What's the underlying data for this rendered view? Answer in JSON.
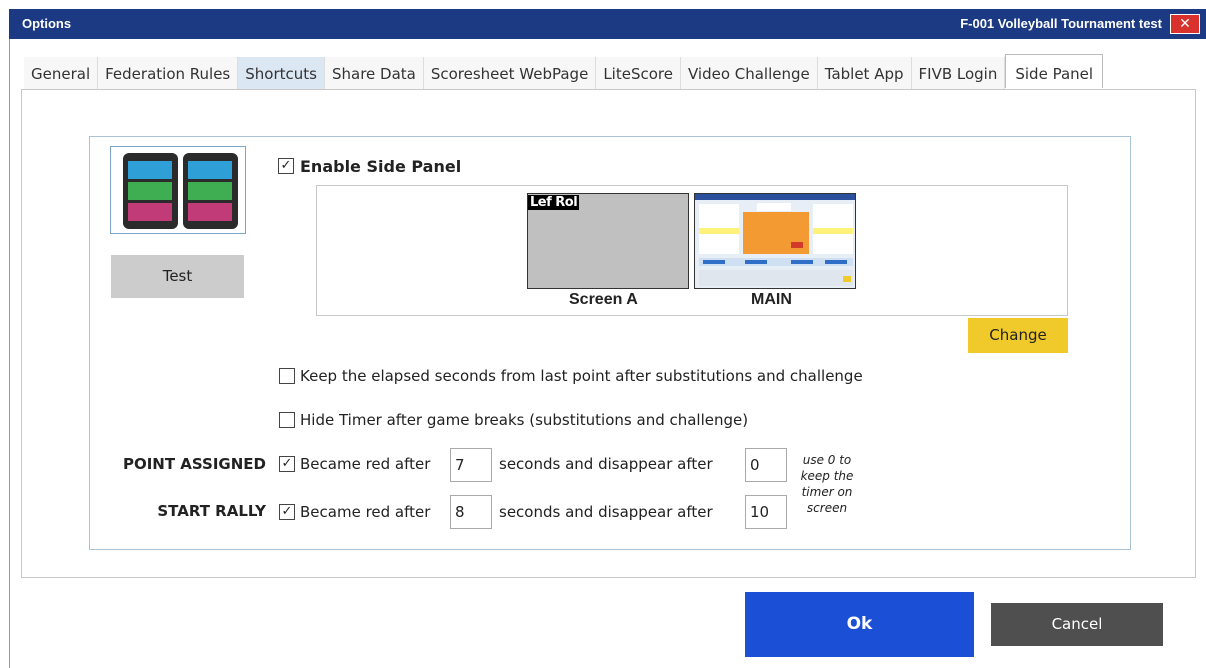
{
  "window": {
    "title": "Options",
    "event_title": "F-001  Volleyball Tournament test",
    "close_label": "✕"
  },
  "tabs": [
    {
      "label": "General"
    },
    {
      "label": "Federation Rules"
    },
    {
      "label": "Shortcuts"
    },
    {
      "label": "Share Data"
    },
    {
      "label": "Scoresheet WebPage"
    },
    {
      "label": "LiteScore"
    },
    {
      "label": "Video Challenge"
    },
    {
      "label": "Tablet App"
    },
    {
      "label": "FIVB Login"
    },
    {
      "label": "Side Panel"
    }
  ],
  "active_tab": "Side Panel",
  "side_panel": {
    "test_label": "Test",
    "enable_label": "Enable Side Panel",
    "enable_checked": true,
    "screen_a_label": "Screen A",
    "screen_a_overlay": "Lef  Rol",
    "screen_main_label": "MAIN",
    "change_label": "Change",
    "keep_elapsed_label": "Keep the elapsed seconds from last point after substitutions and challenge",
    "keep_elapsed_checked": false,
    "hide_timer_label": "Hide Timer after game breaks (substitutions and challenge)",
    "hide_timer_checked": false,
    "point_assigned": {
      "label": "POINT ASSIGNED",
      "checked": true,
      "became_red_label": "Became red after",
      "red_value": "7",
      "disappear_label": "seconds and disappear after",
      "disappear_value": "0"
    },
    "start_rally": {
      "label": "START RALLY",
      "checked": true,
      "became_red_label": "Became red after",
      "red_value": "8",
      "disappear_label": "seconds and disappear after",
      "disappear_value": "10"
    },
    "hint": "use 0 to keep the timer on screen"
  },
  "footer": {
    "ok_label": "Ok",
    "cancel_label": "Cancel"
  },
  "colors": {
    "titlebar": "#1b3a83",
    "change_button": "#f0c92b",
    "ok_button": "#1a4fd6",
    "cancel_button": "#4f4f4f",
    "test_button": "#cccccc"
  }
}
